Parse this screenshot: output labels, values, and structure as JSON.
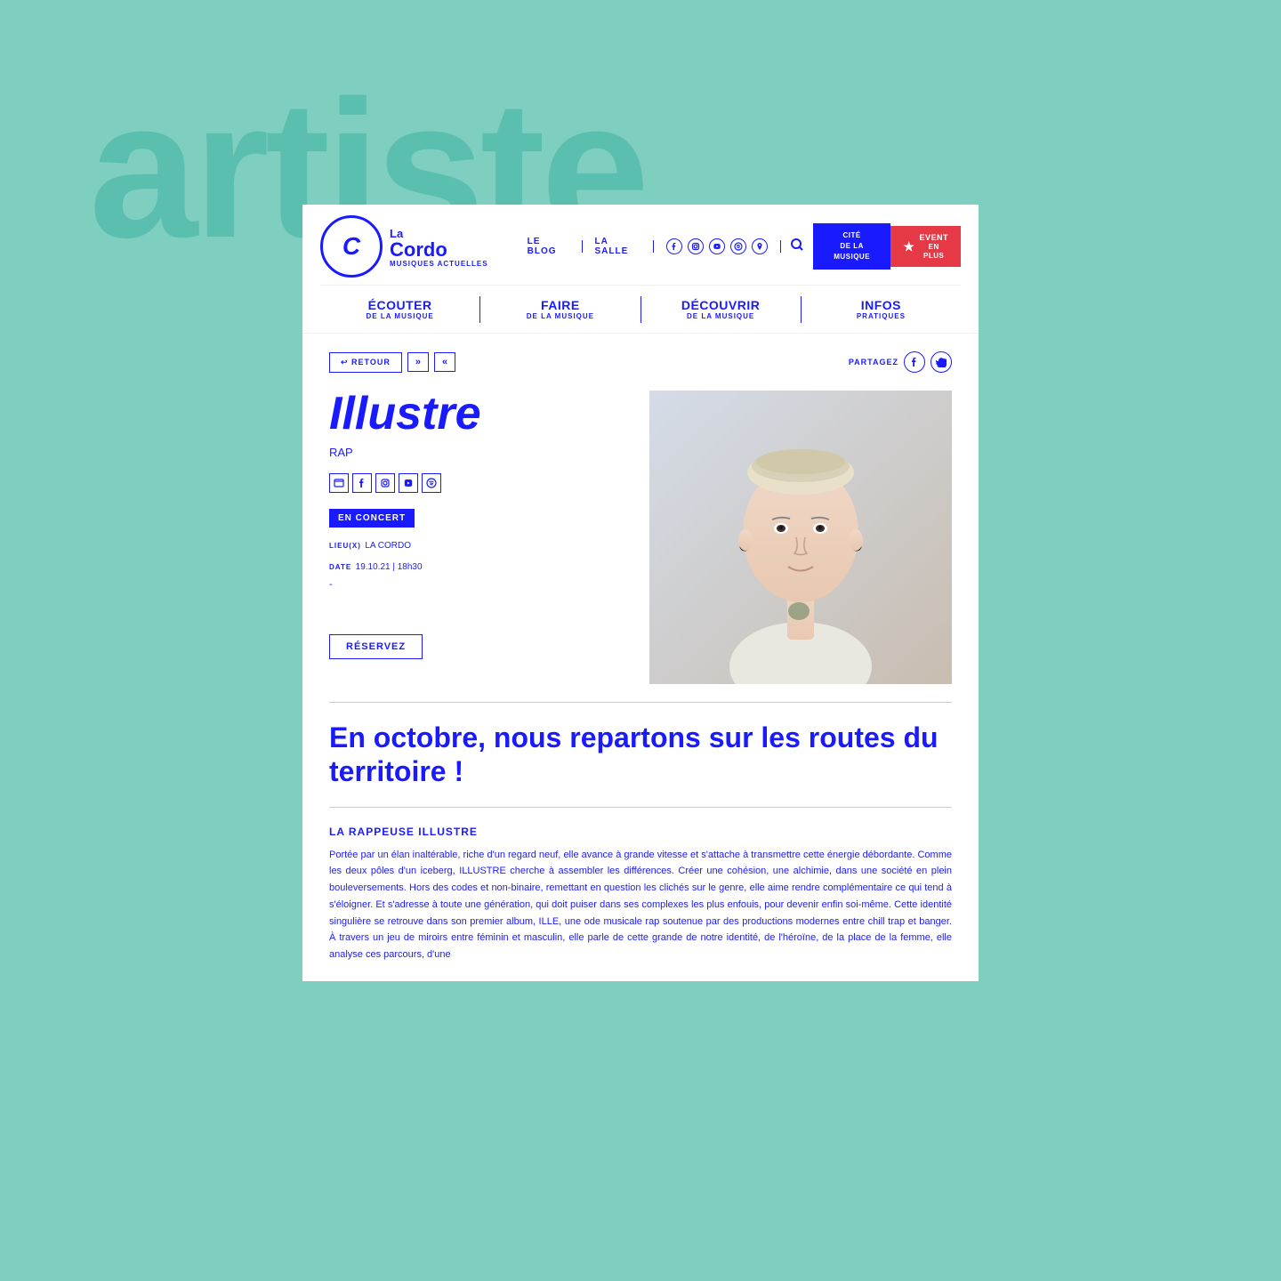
{
  "bg": {
    "text": "artiste"
  },
  "header": {
    "logo": {
      "prefix": "La",
      "name": "Cordo",
      "subtitle": "MUSIQUES ACTUELLES",
      "letter": "C"
    },
    "top_nav": [
      {
        "label": "LE BLOG",
        "id": "blog"
      },
      {
        "label": "LA SALLE",
        "id": "salle"
      }
    ],
    "cta": {
      "cite": {
        "line1": "CITÉ",
        "line2": "DE LA MUSIQUE"
      },
      "event": {
        "line1": "EVENT",
        "line2": "EN PLUS"
      }
    },
    "main_nav": [
      {
        "title": "ÉCOUTER",
        "sub": "DE LA MUSIQUE"
      },
      {
        "title": "FAIRE",
        "sub": "DE LA MUSIQUE"
      },
      {
        "title": "DÉCOUVRIR",
        "sub": "DE LA MUSIQUE"
      },
      {
        "title": "INFOS",
        "sub": "PRATIQUES"
      }
    ]
  },
  "page_nav": {
    "back_label": "↩ RETOUR",
    "prev_label": "»",
    "next_label": "«",
    "share_label": "PARTAGEZ"
  },
  "artist": {
    "name": "Illustre",
    "genre": "RAP",
    "concert_badge": "EN CONCERT",
    "venue_label": "LIEU(X)",
    "venue_value": "LA CORDO",
    "date_label": "DATE",
    "date_value": "19.10.21 | 18h30",
    "reservez": "RÉSERVEZ"
  },
  "article": {
    "main_title": "En octobre, nous repartons  sur les routes du territoire !",
    "section_title": "LA RAPPEUSE ILLUSTRE",
    "body": "Portée par un élan inaltérable, riche d'un regard neuf, elle avance à grande vitesse et s'attache à transmettre cette énergie débordante. Comme les deux pôles d'un iceberg, ILLUSTRE cherche à assembler les différences. Créer une cohésion, une alchimie, dans une société en plein bouleversements. Hors des codes et non-binaire, remettant en question les clichés sur le genre, elle aime rendre complémentaire ce qui tend à s'éloigner. Et s'adresse à toute une génération, qui doit puiser dans ses complexes les plus enfouis, pour devenir enfin soi-même. Cette identité singulière se retrouve dans son premier album, ILLE, une ode musicale rap soutenue par des productions modernes entre chill trap et banger. À travers un jeu de miroirs entre féminin et masculin, elle parle de cette grande de notre identité, de l'héroïne, de la place de la femme, elle analyse ces parcours, d'une"
  },
  "colors": {
    "brand_blue": "#1a1aff",
    "bg_mint": "#7ECFC0",
    "white": "#ffffff",
    "red": "#e63946"
  }
}
